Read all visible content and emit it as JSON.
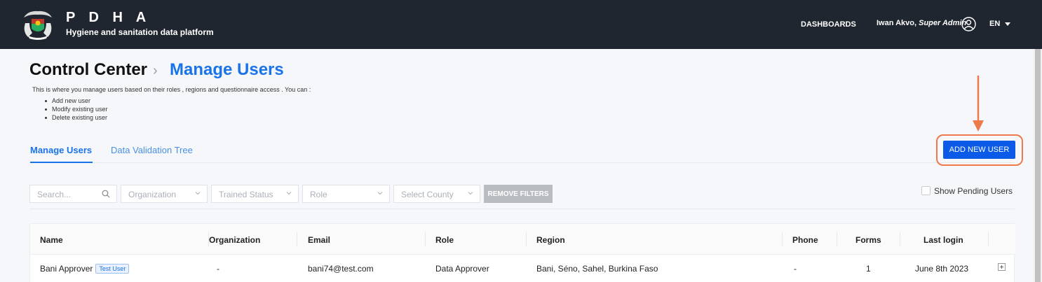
{
  "header": {
    "title": "P D H A",
    "subtitle": "Hygiene and sanitation data platform",
    "nav_dashboards": "DASHBOARDS",
    "user_name": "Iwan Akvo,",
    "user_role": "Super Admin",
    "language": "EN",
    "logo_icon": "coat-of-arms-logo",
    "user_icon": "user-circle-icon"
  },
  "breadcrumb": {
    "root": "Control Center",
    "separator": "›",
    "current": "Manage Users"
  },
  "description": {
    "intro": "This is where you manage users based on their roles , regions and questionnaire access . You can :",
    "bullets": [
      "Add new user",
      "Modify existing user",
      "Delete existing user"
    ]
  },
  "tabs": [
    {
      "label": "Manage Users",
      "active": true
    },
    {
      "label": "Data Validation Tree",
      "active": false
    }
  ],
  "actions": {
    "add_new_user": "ADD NEW USER"
  },
  "filters": {
    "search_placeholder": "Search...",
    "organization": "Organization",
    "trained_status": "Trained Status",
    "role": "Role",
    "county": "Select County",
    "remove_filters": "REMOVE FILTERS",
    "show_pending": "Show Pending Users"
  },
  "table": {
    "columns": [
      "Name",
      "Organization",
      "Email",
      "Role",
      "Region",
      "Phone",
      "Forms",
      "Last login"
    ],
    "rows": [
      {
        "name": "Bani Approver",
        "badge": "Test User",
        "organization": "-",
        "email": "bani74@test.com",
        "role": "Data Approver",
        "region": "Bani, Séno, Sahel, Burkina Faso",
        "phone": "-",
        "forms": "1",
        "last_login": "June 8th 2023"
      }
    ]
  },
  "colors": {
    "topbar": "#1f2630",
    "accent": "#1a73e8",
    "button": "#0b5be8",
    "annotation": "#ee7a4b"
  }
}
